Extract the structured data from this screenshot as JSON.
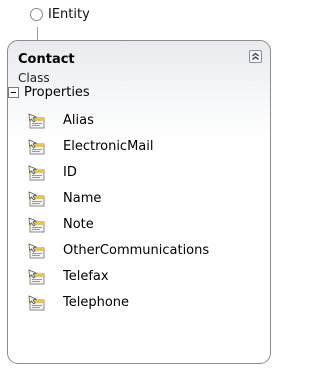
{
  "interface": {
    "name": "IEntity"
  },
  "class": {
    "name": "Contact",
    "kind": "Class",
    "compartment": {
      "label": "Properties",
      "items": [
        {
          "label": "Alias",
          "icon": "property-icon"
        },
        {
          "label": "ElectronicMail",
          "icon": "property-icon"
        },
        {
          "label": "ID",
          "icon": "property-icon"
        },
        {
          "label": "Name",
          "icon": "property-icon"
        },
        {
          "label": "Note",
          "icon": "property-icon"
        },
        {
          "label": "OtherCommunications",
          "icon": "property-icon"
        },
        {
          "label": "Telefax",
          "icon": "property-icon"
        },
        {
          "label": "Telephone",
          "icon": "property-icon"
        }
      ]
    }
  },
  "colors": {
    "border": "#8c8c8c",
    "header_gradient_top": "#e8eaee"
  }
}
